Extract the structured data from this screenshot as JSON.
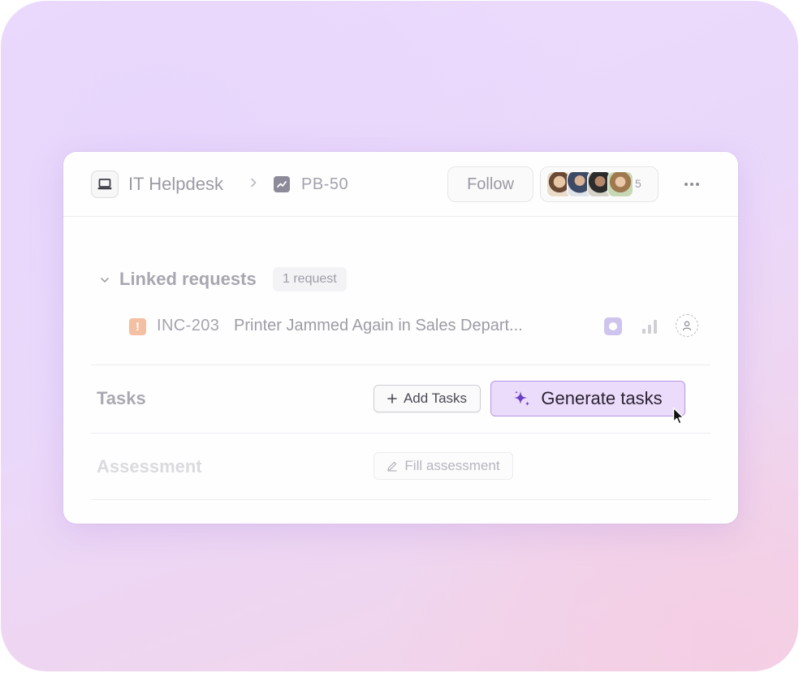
{
  "colors": {
    "background_top": "#ecdcfc",
    "background_bottom": "#f3d3e6",
    "generate_accent": "#b695e8",
    "generate_fill": "#ecdcfb",
    "warning": "#f4c0a3",
    "status": "#cfc4ee"
  },
  "header": {
    "project_icon": "laptop-icon",
    "project_name": "IT Helpdesk",
    "separator_icon": "chevron-right-icon",
    "issue_type_icon": "trend-chart-icon",
    "issue_key": "PB-50",
    "follow_label": "Follow",
    "watchers_count": "5",
    "more_icon": "ellipsis-icon"
  },
  "linked_requests": {
    "toggle_icon": "chevron-down-icon",
    "title": "Linked requests",
    "badge": "1 request",
    "items": [
      {
        "type_icon": "warning-icon",
        "type_glyph": "!",
        "key": "INC-203",
        "title": "Printer Jammed Again in Sales Depart...",
        "status_icon": "status-icon",
        "priority_icon": "priority-bars-icon",
        "assignee_icon": "unassigned-user-icon"
      }
    ]
  },
  "tasks": {
    "label": "Tasks",
    "add_label": "Add Tasks",
    "generate_label": "Generate tasks"
  },
  "assessment": {
    "label": "Assessment",
    "fill_label": "Fill assessment"
  }
}
